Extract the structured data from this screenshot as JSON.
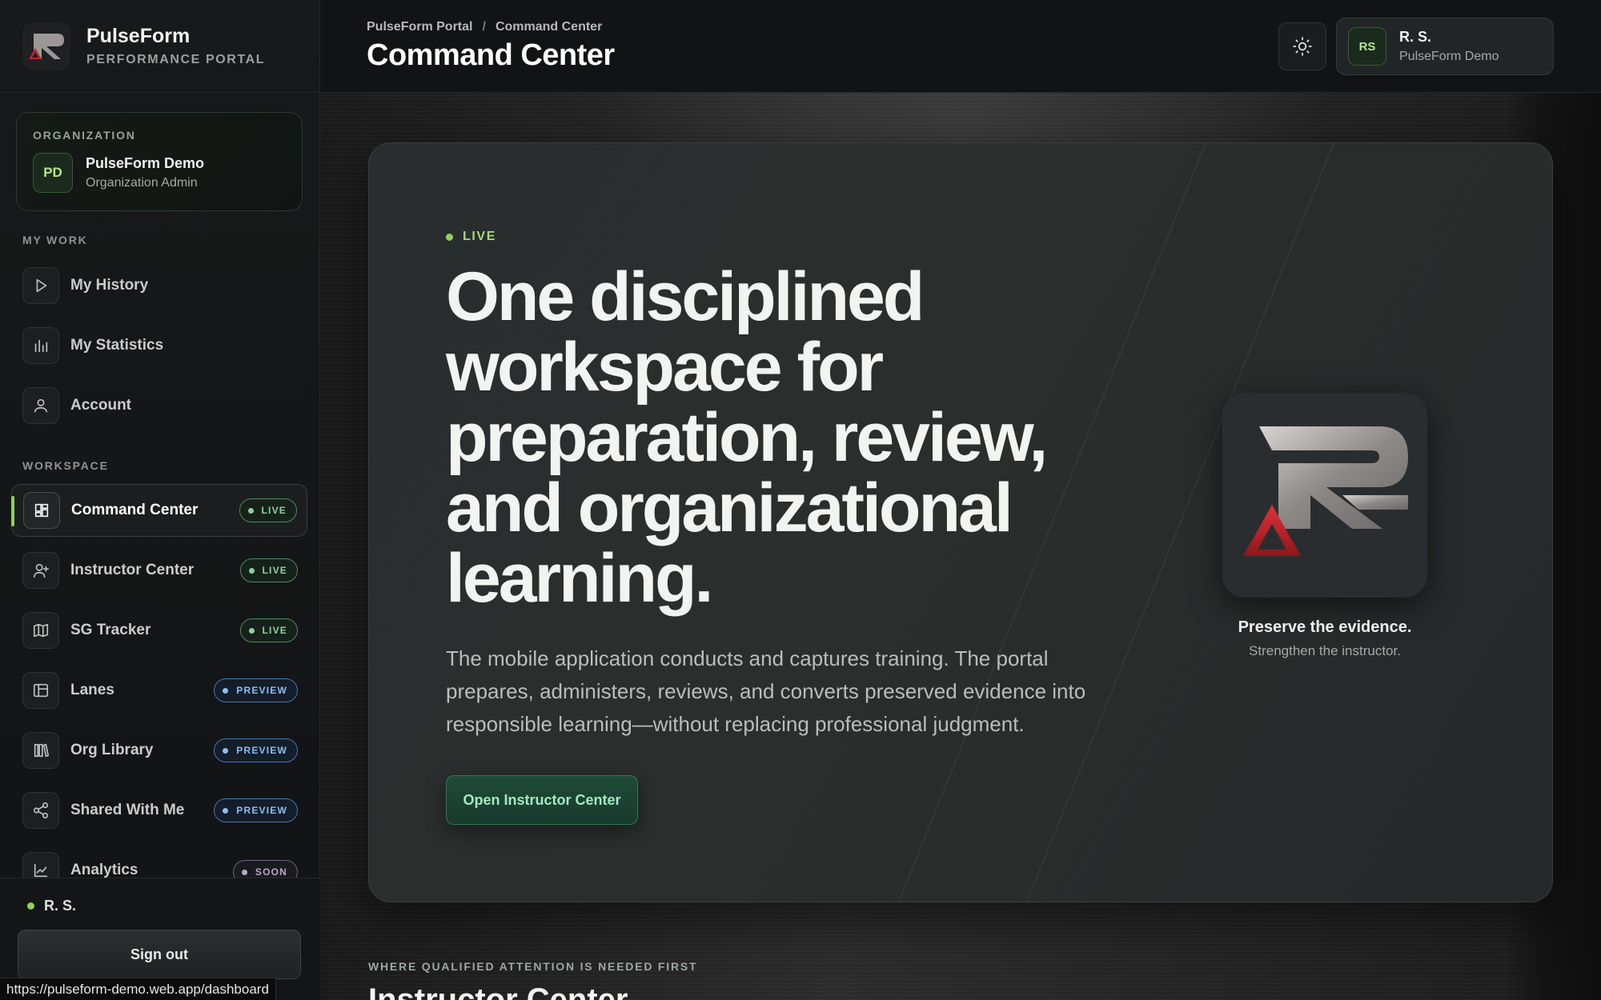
{
  "brand": {
    "name": "PulseForm",
    "subtitle": "PERFORMANCE PORTAL"
  },
  "organization": {
    "kicker": "ORGANIZATION",
    "initials": "PD",
    "name": "PulseForm Demo",
    "role": "Organization Admin"
  },
  "sidebar": {
    "my_work_label": "MY WORK",
    "my_work": [
      {
        "label": "My History",
        "icon": "play-icon"
      },
      {
        "label": "My Statistics",
        "icon": "bar-chart-icon"
      },
      {
        "label": "Account",
        "icon": "user-icon"
      }
    ],
    "workspace_label": "WORKSPACE",
    "workspace": [
      {
        "label": "Command Center",
        "badge": "LIVE",
        "icon": "dashboard-grid-icon",
        "active": true
      },
      {
        "label": "Instructor Center",
        "badge": "LIVE",
        "icon": "user-plus-icon"
      },
      {
        "label": "SG Tracker",
        "badge": "LIVE",
        "icon": "map-icon"
      },
      {
        "label": "Lanes",
        "badge": "PREVIEW",
        "icon": "layout-panel-icon"
      },
      {
        "label": "Org Library",
        "badge": "PREVIEW",
        "icon": "library-icon"
      },
      {
        "label": "Shared With Me",
        "badge": "PREVIEW",
        "icon": "share-icon"
      },
      {
        "label": "Analytics",
        "badge": "SOON",
        "icon": "line-chart-icon"
      }
    ],
    "footer_user": "R. S.",
    "sign_out": "Sign out"
  },
  "status_url": "https://pulseform-demo.web.app/dashboard",
  "header": {
    "breadcrumb": [
      "PulseForm Portal",
      "/",
      "Command Center"
    ],
    "title": "Command Center",
    "user": {
      "initials": "RS",
      "name": "R. S.",
      "org": "PulseForm Demo"
    }
  },
  "hero": {
    "status": "LIVE",
    "headline": "One disciplined workspace for preparation, review, and organizational learning.",
    "body": "The mobile application conducts and captures training. The portal prepares, administers, reviews, and converts preserved evidence into responsible learning—without replacing professional judgment.",
    "cta": "Open Instructor Center",
    "tagline": "Preserve the evidence.",
    "subtagline": "Strengthen the instructor."
  },
  "next_section": {
    "kicker": "WHERE QUALIFIED ATTENTION IS NEEDED FIRST",
    "title": "Instructor Center"
  },
  "colors": {
    "accent_green": "#8fd25a",
    "live_badge": "#8fcfa4",
    "preview_badge": "#8dbdf0",
    "soon_badge": "#b4abc7",
    "cta_bg": "#1f4a38",
    "logo_red": "#c0242b"
  }
}
